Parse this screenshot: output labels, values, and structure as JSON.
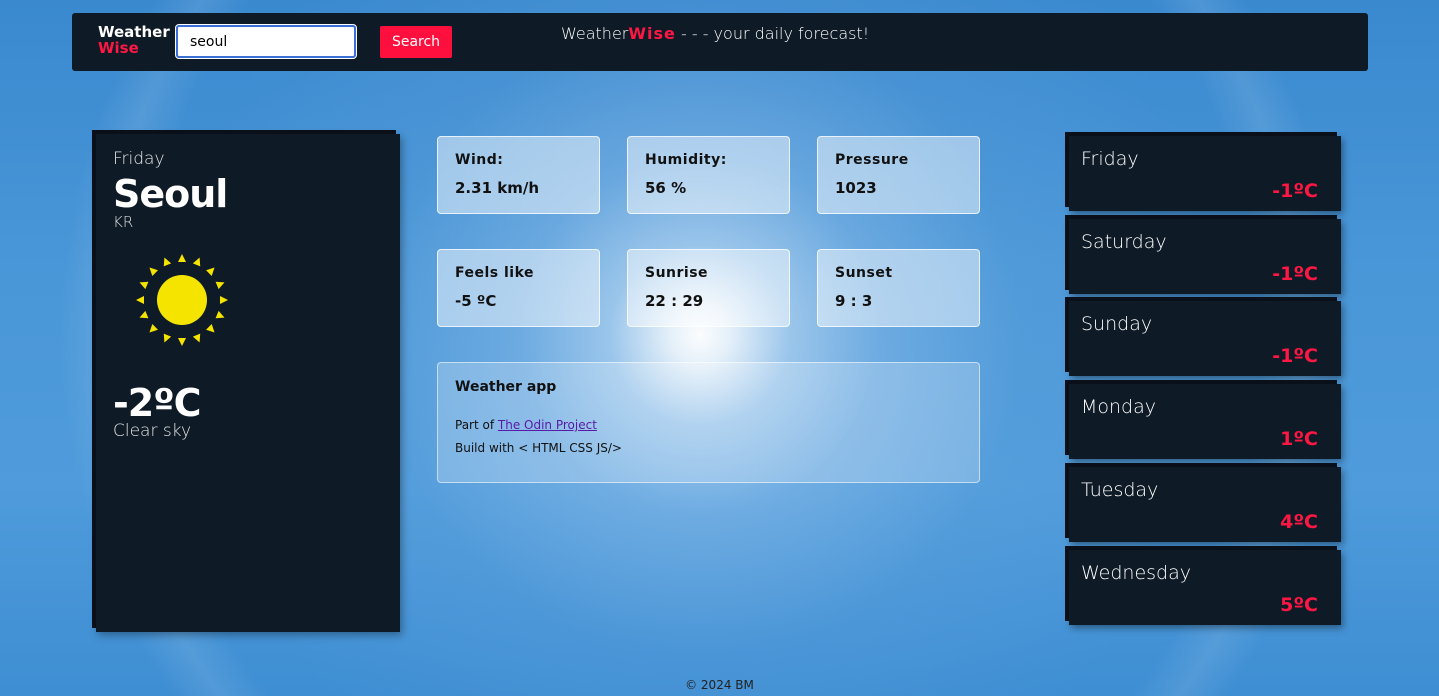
{
  "header": {
    "logo_line1": "Weather",
    "logo_line2": "Wise",
    "search_value": "seoul",
    "search_button": "Search",
    "tagline_brand_a": "Weather",
    "tagline_brand_b": "Wise",
    "tagline_rest": " - - - your daily forecast!"
  },
  "current": {
    "day": "Friday",
    "city": "Seoul",
    "country": "KR",
    "icon": "sun-icon",
    "temperature": "-2ºC",
    "description": "Clear sky",
    "icon_color": "#f5e400"
  },
  "stats": [
    {
      "label": "Wind:",
      "value": "2.31 km/h"
    },
    {
      "label": "Humidity:",
      "value": "56 %"
    },
    {
      "label": "Pressure",
      "value": "1023"
    },
    {
      "label": "Feels like",
      "value": "-5 ºC"
    },
    {
      "label": "Sunrise",
      "value": "22 : 29"
    },
    {
      "label": "Sunset",
      "value": "9 : 3"
    }
  ],
  "about": {
    "title": "Weather app",
    "line1_prefix": "Part of ",
    "line1_link": "The Odin Project",
    "line2": "Build with < HTML CSS JS/>"
  },
  "forecast": [
    {
      "day": "Friday",
      "temp": "-1ºC"
    },
    {
      "day": "Saturday",
      "temp": "-1ºC"
    },
    {
      "day": "Sunday",
      "temp": "-1ºC"
    },
    {
      "day": "Monday",
      "temp": "1ºC"
    },
    {
      "day": "Tuesday",
      "temp": "4ºC"
    },
    {
      "day": "Wednesday",
      "temp": "5ºC"
    }
  ],
  "footer": "© 2024 BM",
  "colors": {
    "accent": "#ff1744",
    "panel": "#0e1a26"
  }
}
